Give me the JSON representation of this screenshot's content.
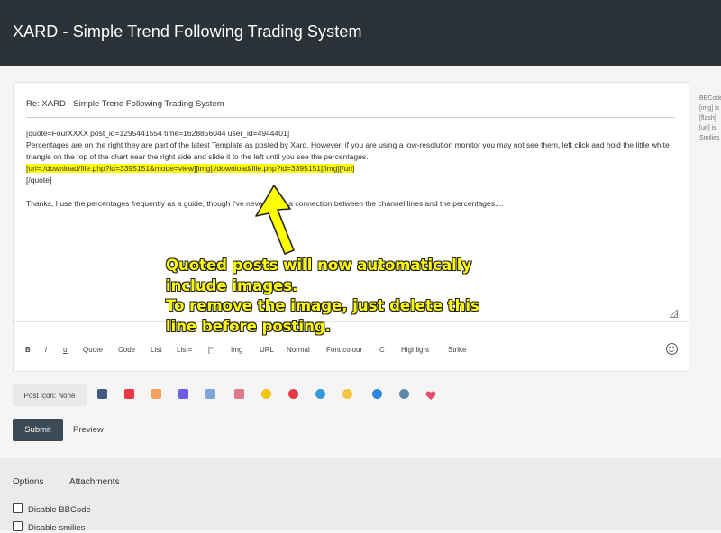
{
  "header": {
    "title": "XARD - Simple Trend Following Trading System"
  },
  "editor": {
    "subject": "Re: XARD - Simple Trend Following Trading System",
    "message_lines": [
      {
        "text": "[quote=FourXXXX post_id=1295441554 time=1628856044 user_id=4944401]",
        "highlight": false
      },
      {
        "text": "Percentages are on the right they are part of the latest Template as posted by Xard. However, if you are using a low-resolution monitor you may not see them, left click and hold the little white triangle on the top of the chart near the right side and slide it to the left until you see the percentages.",
        "highlight": false
      },
      {
        "text": "[url=./download/file.php?id=3395151&mode=view][img]./download/file.php?id=3395151[/img][/url]",
        "highlight": true
      },
      {
        "text": "[/quote]",
        "highlight": false
      },
      {
        "text": "",
        "highlight": false
      },
      {
        "text": "Thanks, I use the percentages frequently as a guide, though I've never made a connection between the channel lines and the percentages....",
        "highlight": false
      }
    ],
    "toolbar": [
      "B",
      "i",
      "u",
      "Quote",
      "Code",
      "List",
      "List=",
      "[*]",
      "Img",
      "URL",
      "Normal",
      "Font colour",
      "C",
      "Highlight",
      "Strike"
    ],
    "emoji_icon": "smiley-icon"
  },
  "side_help": [
    "BBCode",
    "[img] is",
    "[flash]",
    "[url] is",
    "Smilies"
  ],
  "post_icon": {
    "label": "Post Icon: None",
    "icons": [
      {
        "name": "floppy-icon",
        "color": "#3d5a80"
      },
      {
        "name": "traffic-light-icon",
        "color": "#e63946"
      },
      {
        "name": "chart-icon",
        "color": "#f4a261"
      },
      {
        "name": "bars-icon",
        "color": "#6c5ce7"
      },
      {
        "name": "thumbs-up-icon",
        "color": "#7fa7d8"
      },
      {
        "name": "thumbs-down-icon",
        "color": "#e07a8a"
      },
      {
        "name": "info-icon",
        "color": "#f1c40f"
      },
      {
        "name": "alert-icon",
        "color": "#e63946"
      },
      {
        "name": "question-icon",
        "color": "#3498db"
      },
      {
        "name": "lightbulb-icon",
        "color": "#f4c542"
      },
      {
        "name": "magnifier-icon",
        "color": "#2e86de"
      },
      {
        "name": "gear-icon",
        "color": "#5d8aa8"
      },
      {
        "name": "heart-icon",
        "color": "#e84a6b"
      }
    ]
  },
  "actions": {
    "submit": "Submit",
    "preview": "Preview"
  },
  "options": {
    "tabs": [
      "Options",
      "Attachments"
    ],
    "checkboxes": [
      "Disable BBCode",
      "Disable smilies"
    ]
  },
  "annotation": {
    "lines": [
      "Quoted posts will now automatically",
      "include images.",
      "To remove the image, just delete this",
      "line before posting."
    ],
    "color": "#ffff00"
  }
}
